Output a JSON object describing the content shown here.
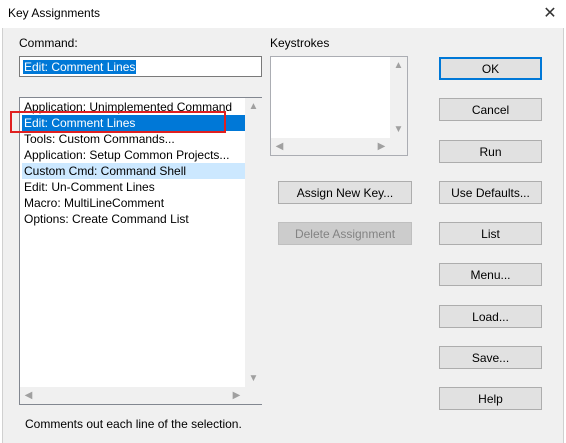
{
  "window": {
    "title": "Key Assignments",
    "close_glyph": "✕"
  },
  "command": {
    "label": "Command:",
    "value": "Edit: Comment Lines"
  },
  "command_list": {
    "items": [
      "Application: Unimplemented Command",
      "Edit: Comment Lines",
      "Tools: Custom Commands...",
      "Application: Setup Common Projects...",
      "Custom Cmd: Command Shell",
      "Edit: Un-Comment Lines",
      "Macro: MultiLineComment",
      "Options: Create Command List"
    ],
    "selected": "Edit: Comment Lines",
    "highlighted": "Custom Cmd: Command Shell"
  },
  "keystrokes": {
    "label": "Keystrokes"
  },
  "buttons": {
    "ok": "OK",
    "cancel": "Cancel",
    "run": "Run",
    "use_defaults": "Use Defaults...",
    "list": "List",
    "menu": "Menu...",
    "load": "Load...",
    "save": "Save...",
    "help": "Help",
    "assign_new_key": "Assign New Key...",
    "delete_assignment": "Delete Assignment"
  },
  "status": {
    "description": "Comments out each line of the selection."
  },
  "colors": {
    "selection": "#0078d7",
    "hover": "#cce8ff",
    "annotation_box": "#e02020"
  }
}
